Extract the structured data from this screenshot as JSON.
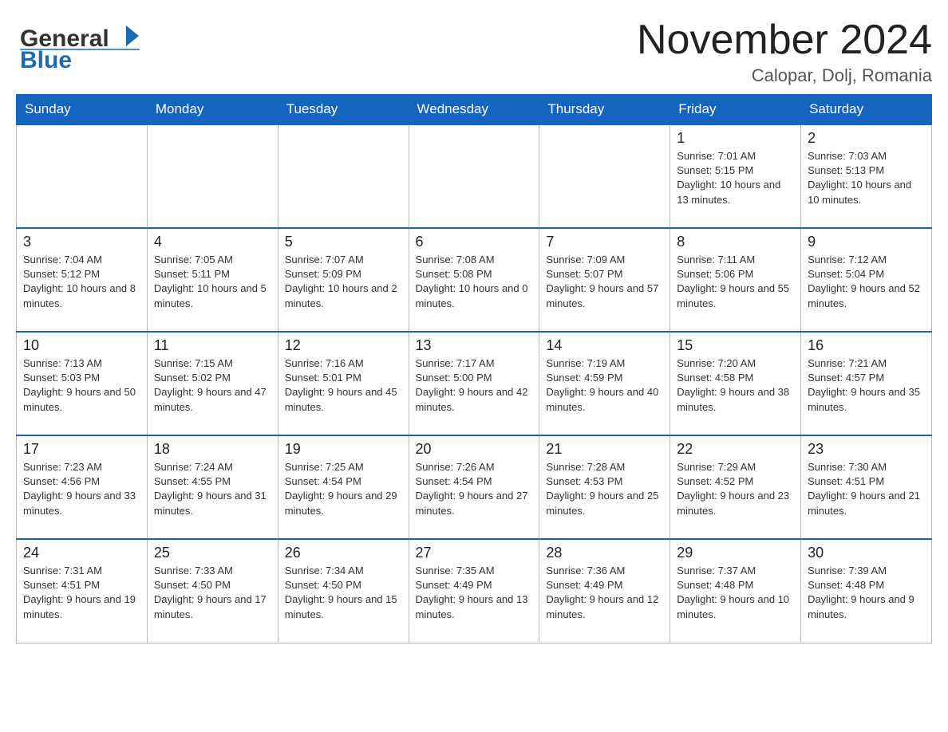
{
  "header": {
    "logo_general": "General",
    "logo_blue": "Blue",
    "month_title": "November 2024",
    "location": "Calopar, Dolj, Romania"
  },
  "days_of_week": [
    "Sunday",
    "Monday",
    "Tuesday",
    "Wednesday",
    "Thursday",
    "Friday",
    "Saturday"
  ],
  "weeks": [
    [
      null,
      null,
      null,
      null,
      null,
      {
        "day": "1",
        "sunrise": "Sunrise: 7:01 AM",
        "sunset": "Sunset: 5:15 PM",
        "daylight": "Daylight: 10 hours and 13 minutes."
      },
      {
        "day": "2",
        "sunrise": "Sunrise: 7:03 AM",
        "sunset": "Sunset: 5:13 PM",
        "daylight": "Daylight: 10 hours and 10 minutes."
      }
    ],
    [
      {
        "day": "3",
        "sunrise": "Sunrise: 7:04 AM",
        "sunset": "Sunset: 5:12 PM",
        "daylight": "Daylight: 10 hours and 8 minutes."
      },
      {
        "day": "4",
        "sunrise": "Sunrise: 7:05 AM",
        "sunset": "Sunset: 5:11 PM",
        "daylight": "Daylight: 10 hours and 5 minutes."
      },
      {
        "day": "5",
        "sunrise": "Sunrise: 7:07 AM",
        "sunset": "Sunset: 5:09 PM",
        "daylight": "Daylight: 10 hours and 2 minutes."
      },
      {
        "day": "6",
        "sunrise": "Sunrise: 7:08 AM",
        "sunset": "Sunset: 5:08 PM",
        "daylight": "Daylight: 10 hours and 0 minutes."
      },
      {
        "day": "7",
        "sunrise": "Sunrise: 7:09 AM",
        "sunset": "Sunset: 5:07 PM",
        "daylight": "Daylight: 9 hours and 57 minutes."
      },
      {
        "day": "8",
        "sunrise": "Sunrise: 7:11 AM",
        "sunset": "Sunset: 5:06 PM",
        "daylight": "Daylight: 9 hours and 55 minutes."
      },
      {
        "day": "9",
        "sunrise": "Sunrise: 7:12 AM",
        "sunset": "Sunset: 5:04 PM",
        "daylight": "Daylight: 9 hours and 52 minutes."
      }
    ],
    [
      {
        "day": "10",
        "sunrise": "Sunrise: 7:13 AM",
        "sunset": "Sunset: 5:03 PM",
        "daylight": "Daylight: 9 hours and 50 minutes."
      },
      {
        "day": "11",
        "sunrise": "Sunrise: 7:15 AM",
        "sunset": "Sunset: 5:02 PM",
        "daylight": "Daylight: 9 hours and 47 minutes."
      },
      {
        "day": "12",
        "sunrise": "Sunrise: 7:16 AM",
        "sunset": "Sunset: 5:01 PM",
        "daylight": "Daylight: 9 hours and 45 minutes."
      },
      {
        "day": "13",
        "sunrise": "Sunrise: 7:17 AM",
        "sunset": "Sunset: 5:00 PM",
        "daylight": "Daylight: 9 hours and 42 minutes."
      },
      {
        "day": "14",
        "sunrise": "Sunrise: 7:19 AM",
        "sunset": "Sunset: 4:59 PM",
        "daylight": "Daylight: 9 hours and 40 minutes."
      },
      {
        "day": "15",
        "sunrise": "Sunrise: 7:20 AM",
        "sunset": "Sunset: 4:58 PM",
        "daylight": "Daylight: 9 hours and 38 minutes."
      },
      {
        "day": "16",
        "sunrise": "Sunrise: 7:21 AM",
        "sunset": "Sunset: 4:57 PM",
        "daylight": "Daylight: 9 hours and 35 minutes."
      }
    ],
    [
      {
        "day": "17",
        "sunrise": "Sunrise: 7:23 AM",
        "sunset": "Sunset: 4:56 PM",
        "daylight": "Daylight: 9 hours and 33 minutes."
      },
      {
        "day": "18",
        "sunrise": "Sunrise: 7:24 AM",
        "sunset": "Sunset: 4:55 PM",
        "daylight": "Daylight: 9 hours and 31 minutes."
      },
      {
        "day": "19",
        "sunrise": "Sunrise: 7:25 AM",
        "sunset": "Sunset: 4:54 PM",
        "daylight": "Daylight: 9 hours and 29 minutes."
      },
      {
        "day": "20",
        "sunrise": "Sunrise: 7:26 AM",
        "sunset": "Sunset: 4:54 PM",
        "daylight": "Daylight: 9 hours and 27 minutes."
      },
      {
        "day": "21",
        "sunrise": "Sunrise: 7:28 AM",
        "sunset": "Sunset: 4:53 PM",
        "daylight": "Daylight: 9 hours and 25 minutes."
      },
      {
        "day": "22",
        "sunrise": "Sunrise: 7:29 AM",
        "sunset": "Sunset: 4:52 PM",
        "daylight": "Daylight: 9 hours and 23 minutes."
      },
      {
        "day": "23",
        "sunrise": "Sunrise: 7:30 AM",
        "sunset": "Sunset: 4:51 PM",
        "daylight": "Daylight: 9 hours and 21 minutes."
      }
    ],
    [
      {
        "day": "24",
        "sunrise": "Sunrise: 7:31 AM",
        "sunset": "Sunset: 4:51 PM",
        "daylight": "Daylight: 9 hours and 19 minutes."
      },
      {
        "day": "25",
        "sunrise": "Sunrise: 7:33 AM",
        "sunset": "Sunset: 4:50 PM",
        "daylight": "Daylight: 9 hours and 17 minutes."
      },
      {
        "day": "26",
        "sunrise": "Sunrise: 7:34 AM",
        "sunset": "Sunset: 4:50 PM",
        "daylight": "Daylight: 9 hours and 15 minutes."
      },
      {
        "day": "27",
        "sunrise": "Sunrise: 7:35 AM",
        "sunset": "Sunset: 4:49 PM",
        "daylight": "Daylight: 9 hours and 13 minutes."
      },
      {
        "day": "28",
        "sunrise": "Sunrise: 7:36 AM",
        "sunset": "Sunset: 4:49 PM",
        "daylight": "Daylight: 9 hours and 12 minutes."
      },
      {
        "day": "29",
        "sunrise": "Sunrise: 7:37 AM",
        "sunset": "Sunset: 4:48 PM",
        "daylight": "Daylight: 9 hours and 10 minutes."
      },
      {
        "day": "30",
        "sunrise": "Sunrise: 7:39 AM",
        "sunset": "Sunset: 4:48 PM",
        "daylight": "Daylight: 9 hours and 9 minutes."
      }
    ]
  ]
}
